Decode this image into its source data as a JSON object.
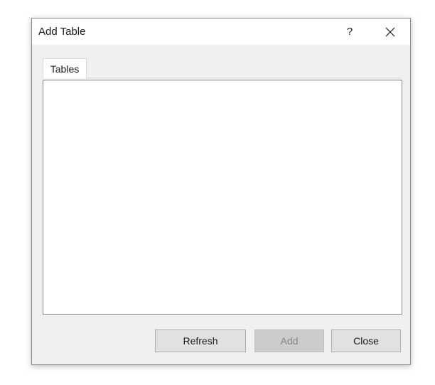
{
  "dialog": {
    "title": "Add Table",
    "help_label": "?",
    "close_icon": "close-icon"
  },
  "tabs": [
    {
      "label": "Tables",
      "selected": true
    }
  ],
  "table_list": {
    "items": []
  },
  "buttons": {
    "refresh_label": "Refresh",
    "add_label": "Add",
    "add_enabled": false,
    "close_label": "Close"
  },
  "colors": {
    "dialog_bg": "#f0f0f0",
    "titlebar_bg": "#ffffff",
    "button_bg": "#e1e1e1",
    "disabled_button_bg": "#cccccc",
    "disabled_text": "#838383"
  }
}
